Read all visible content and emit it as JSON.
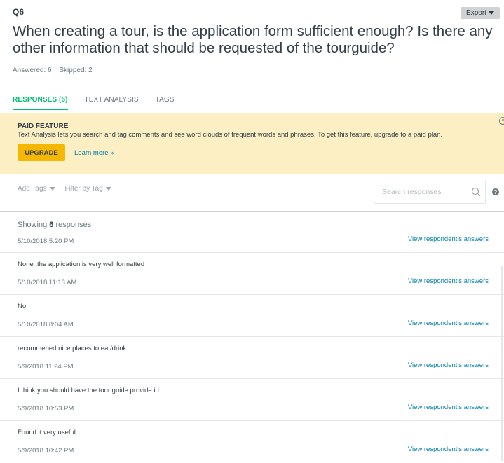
{
  "question": {
    "number": "Q6",
    "title": "When creating a tour, is the application form sufficient enough? Is there any other information that should be requested of the tourguide?",
    "answered": "Answered: 6",
    "skipped": "Skipped: 2",
    "export_label": "Export"
  },
  "tabs": [
    {
      "label": "RESPONSES (6)",
      "active": true
    },
    {
      "label": "TEXT ANALYSIS",
      "active": false
    },
    {
      "label": "TAGS",
      "active": false
    }
  ],
  "banner": {
    "title": "PAID FEATURE",
    "text": "Text Analysis lets you search and tag comments and see word clouds of frequent words and phrases. To get this feature, upgrade to a paid plan.",
    "upgrade_label": "UPGRADE",
    "learn_more": "Learn more »"
  },
  "toolbar": {
    "add_tags": "Add Tags",
    "filter_by_tag": "Filter by Tag",
    "search_placeholder": "Search responses"
  },
  "list": {
    "showing_prefix": "Showing ",
    "showing_count": "6",
    "showing_suffix": " responses",
    "view_label": "View respondent's answers",
    "first_date": "5/10/2018 5:20 PM",
    "responses": [
      {
        "text": "None ,the application is very well formatted",
        "date": "5/10/2018 11:13 AM"
      },
      {
        "text": "No",
        "date": "5/10/2018 8:04 AM"
      },
      {
        "text": "recommened nice places to eat/drink",
        "date": "5/9/2018 11:24 PM"
      },
      {
        "text": "I think you should have the tour guide provide id",
        "date": "5/9/2018 10:53 PM"
      },
      {
        "text": "Found it very useful",
        "date": "5/9/2018 10:42 PM"
      }
    ]
  },
  "colors": {
    "accent": "#00bf6f",
    "link": "#007faa",
    "banner_bg": "#fcefc4",
    "upgrade_bg": "#f5b700"
  }
}
